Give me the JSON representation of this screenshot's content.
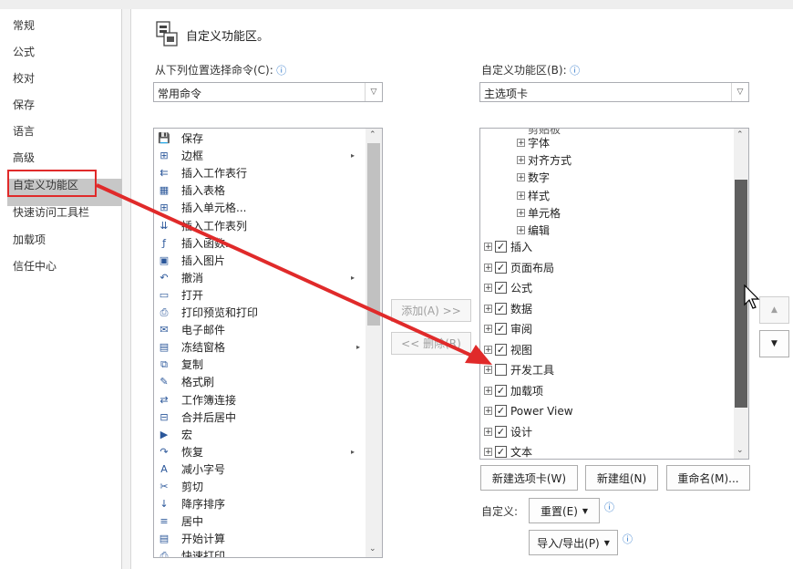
{
  "nav": {
    "items": [
      "常规",
      "公式",
      "校对",
      "保存",
      "语言",
      "高级",
      "自定义功能区",
      "快速访问工具栏",
      "加载项",
      "信任中心"
    ],
    "selected": "自定义功能区"
  },
  "header": {
    "title": "自定义功能区。"
  },
  "left": {
    "label": "从下列位置选择命令(C):",
    "dropdown_value": "常用命令",
    "commands": [
      {
        "icon": "save-icon",
        "label": "保存"
      },
      {
        "icon": "border-icon",
        "label": "边框",
        "submenu": true
      },
      {
        "icon": "insert-row-icon",
        "label": "插入工作表行"
      },
      {
        "icon": "insert-table-icon",
        "label": "插入表格"
      },
      {
        "icon": "insert-cells-icon",
        "label": "插入单元格..."
      },
      {
        "icon": "insert-column-icon",
        "label": "插入工作表列"
      },
      {
        "icon": "function-icon",
        "label": "插入函数..."
      },
      {
        "icon": "insert-picture-icon",
        "label": "插入图片"
      },
      {
        "icon": "undo-icon",
        "label": "撤消",
        "submenu": true
      },
      {
        "icon": "open-folder-icon",
        "label": "打开"
      },
      {
        "icon": "print-preview-icon",
        "label": "打印预览和打印"
      },
      {
        "icon": "email-icon",
        "label": "电子邮件"
      },
      {
        "icon": "freeze-panes-icon",
        "label": "冻结窗格",
        "submenu": true
      },
      {
        "icon": "copy-icon",
        "label": "复制"
      },
      {
        "icon": "format-painter-icon",
        "label": "格式刷"
      },
      {
        "icon": "workbook-link-icon",
        "label": "工作簿连接"
      },
      {
        "icon": "merge-center-icon",
        "label": "合并后居中"
      },
      {
        "icon": "macro-icon",
        "label": "宏"
      },
      {
        "icon": "redo-icon",
        "label": "恢复",
        "submenu": true
      },
      {
        "icon": "decrease-font-icon",
        "label": "减小字号"
      },
      {
        "icon": "cut-icon",
        "label": "剪切"
      },
      {
        "icon": "sort-desc-icon",
        "label": "降序排序"
      },
      {
        "icon": "align-center-icon",
        "label": "居中"
      },
      {
        "icon": "calculate-icon",
        "label": "开始计算"
      },
      {
        "icon": "quick-print-icon",
        "label": "快速打印"
      }
    ]
  },
  "middle": {
    "add_label": "添加(A) >>",
    "remove_label": "<< 删除(R)"
  },
  "right": {
    "label": "自定义功能区(B):",
    "dropdown_value": "主选项卡",
    "partial_top": "剪贴板",
    "subgroups": [
      "字体",
      "对齐方式",
      "数字",
      "样式",
      "单元格",
      "编辑"
    ],
    "tabs": [
      {
        "label": "插入",
        "checked": true
      },
      {
        "label": "页面布局",
        "checked": true
      },
      {
        "label": "公式",
        "checked": true
      },
      {
        "label": "数据",
        "checked": true
      },
      {
        "label": "审阅",
        "checked": true
      },
      {
        "label": "视图",
        "checked": true
      },
      {
        "label": "开发工具",
        "checked": false
      },
      {
        "label": "加载项",
        "checked": true
      },
      {
        "label": "Power View",
        "checked": true
      },
      {
        "label": "设计",
        "checked": true
      },
      {
        "label": "文本",
        "checked": true
      }
    ],
    "new_tab": "新建选项卡(W)",
    "new_group": "新建组(N)",
    "rename": "重命名(M)...",
    "customize_label": "自定义:",
    "reset": "重置(E)",
    "import_export": "导入/导出(P)"
  },
  "colors": {
    "accent_red": "#e02a2a",
    "info_blue": "#2b75c9"
  }
}
